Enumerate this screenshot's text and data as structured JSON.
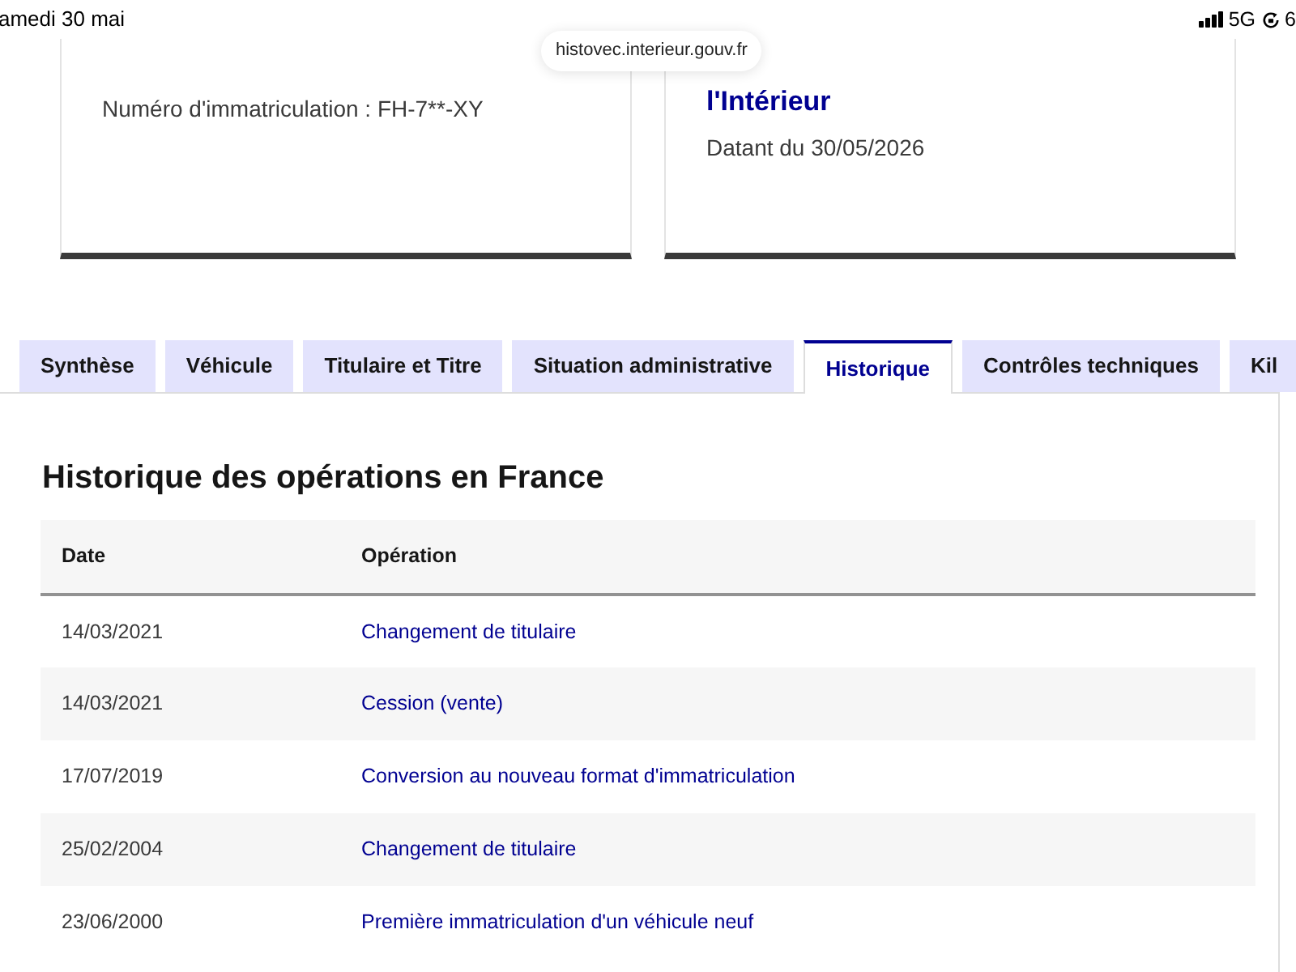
{
  "status_bar": {
    "date": "amedi 30 mai",
    "network": "5G",
    "battery": "6"
  },
  "address_bar": {
    "url": "histovec.interieur.gouv.fr"
  },
  "cards": [
    {
      "lines": [
        {
          "kind": "text",
          "text": "Numéro d'immatriculation : FH-7**-XY"
        }
      ]
    },
    {
      "lines": [
        {
          "kind": "title",
          "text": "l'Intérieur"
        },
        {
          "kind": "text",
          "text": "Datant du 30/05/2026"
        }
      ]
    }
  ],
  "tabs": [
    {
      "label": "Synthèse",
      "selected": false
    },
    {
      "label": "Véhicule",
      "selected": false
    },
    {
      "label": "Titulaire et Titre",
      "selected": false
    },
    {
      "label": "Situation administrative",
      "selected": false
    },
    {
      "label": "Historique",
      "selected": true
    },
    {
      "label": "Contrôles techniques",
      "selected": false
    },
    {
      "label": "Kil",
      "selected": false
    }
  ],
  "section": {
    "title": "Historique des opérations en France",
    "table": {
      "columns": [
        "Date",
        "Opération"
      ],
      "rows": [
        [
          "14/03/2021",
          "Changement de titulaire"
        ],
        [
          "14/03/2021",
          "Cession (vente)"
        ],
        [
          "17/07/2019",
          "Conversion au nouveau format d'immatriculation"
        ],
        [
          "25/02/2004",
          "Changement de titulaire"
        ],
        [
          "23/06/2000",
          "Première immatriculation d'un véhicule neuf"
        ]
      ]
    }
  }
}
